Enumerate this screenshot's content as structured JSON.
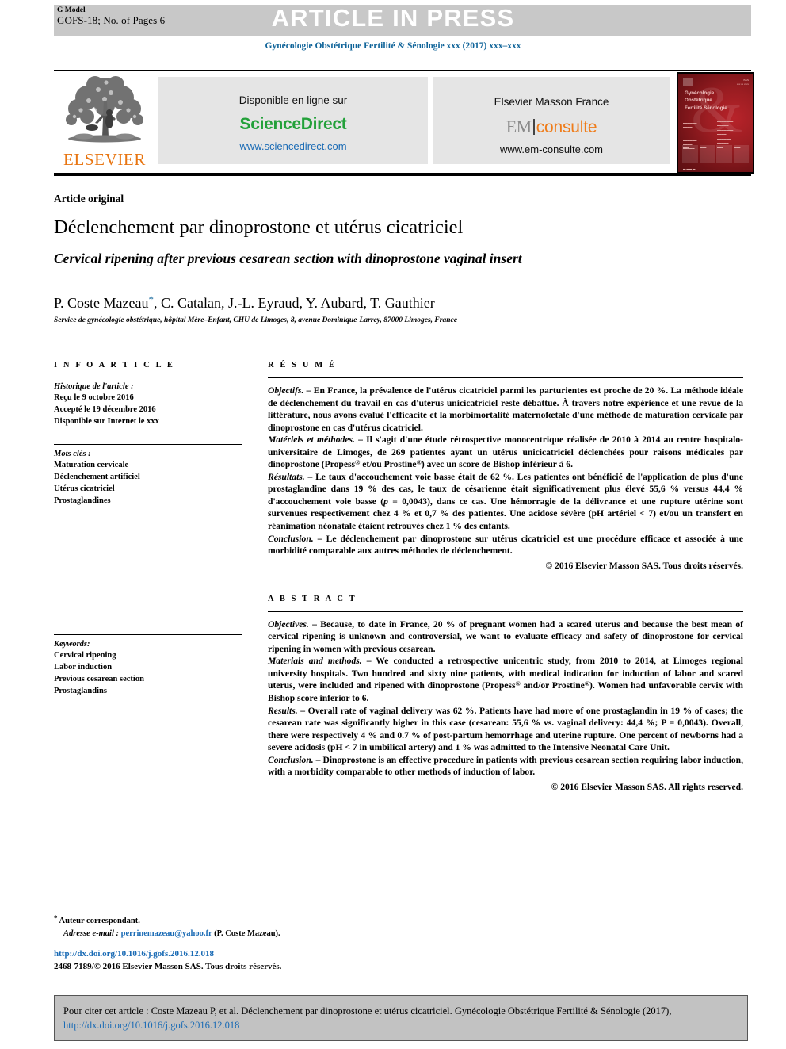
{
  "header": {
    "g_model_label": "G Model",
    "g_model_id": "GOFS-18; No. of Pages 6",
    "banner": "ARTICLE IN PRESS",
    "journal_line": "Gynécologie Obstétrique Fertilité & Sénologie xxx (2017) xxx–xxx"
  },
  "masthead": {
    "elsevier_wordmark": "ELSEVIER",
    "sciencedirect": {
      "available_label": "Disponible en ligne sur",
      "logo": "ScienceDirect",
      "url": "www.sciencedirect.com"
    },
    "em_consulte": {
      "publisher": "Elsevier Masson France",
      "logo_left": "EM",
      "logo_right": "consulte",
      "url": "www.em-consulte.com"
    },
    "cover": {
      "title_lines": "Gynécologie Obstétrique Fertilité Sénologie",
      "ampersand": "&"
    }
  },
  "article": {
    "kind": "Article original",
    "title_fr": "Déclenchement par dinoprostone et utérus cicatriciel",
    "title_en": "Cervical ripening after previous cesarean section with dinoprostone vaginal insert",
    "authors": "P. Coste Mazeau",
    "authors_rest": ", C. Catalan, J.-L. Eyraud, Y. Aubard, T. Gauthier",
    "corresponding_marker": "*",
    "affiliation": "Service de gynécologie obstétrique, hôpital Mère–Enfant, CHU de Limoges, 8, avenue Dominique-Larrey, 87000 Limoges, France"
  },
  "info_article": {
    "heading": "I N F O   A R T I C L E",
    "history_title": "Historique de l'article :",
    "history": [
      "Reçu le 9 octobre 2016",
      "Accepté le 19 décembre 2016",
      "Disponible sur Internet le xxx"
    ],
    "keywords_fr_title": "Mots clés :",
    "keywords_fr": [
      "Maturation cervicale",
      "Déclenchement artificiel",
      "Utérus cicatriciel",
      "Prostaglandines"
    ],
    "keywords_en_title": "Keywords:",
    "keywords_en": [
      "Cervical ripening",
      "Labor induction",
      "Previous cesarean section",
      "Prostaglandins"
    ]
  },
  "resume": {
    "heading": "R É S U M É",
    "objectifs_label": "Objectifs.",
    "objectifs_text": " – En France, la prévalence de l'utérus cicatriciel parmi les parturientes est proche de 20 %. La méthode idéale de déclenchement du travail en cas d'utérus unicicatriciel reste débattue. À travers notre expérience et une revue de la littérature, nous avons évalué l'efficacité et la morbimortalité maternofœtale d'une méthode de maturation cervicale par dinoprostone en cas d'utérus cicatriciel.",
    "materiels_label": "Matériels et méthodes.",
    "materiels_text_a": " – Il s'agit d'une étude rétrospective monocentrique réalisée de 2010 à 2014 au centre hospitalo-universitaire de Limoges, de 269 patientes ayant un utérus unicicatriciel déclenchées pour raisons médicales par dinoprostone (Propess",
    "materiels_text_b": " et/ou Prostine",
    "materiels_text_c": ") avec un score de Bishop inférieur à 6.",
    "resultats_label": "Résultats.",
    "resultats_text_a": " – Le taux d'accouchement voie basse était de 62 %. Les patientes ont bénéficié de l'application de plus d'une prostaglandine dans 19 % des cas, le taux de césarienne était significativement plus élevé 55,6 % versus 44,4 % d'accouchement voie basse (",
    "resultats_text_p": "p",
    "resultats_text_b": " = 0,0043), dans ce cas. Une hémorragie de la délivrance et une rupture utérine sont survenues respectivement chez 4 % et 0,7 % des patientes. Une acidose sévère (pH artériel < 7) et/ou un transfert en réanimation néonatale étaient retrouvés chez 1 % des enfants.",
    "conclusion_label": "Conclusion.",
    "conclusion_text": " – Le déclenchement par dinoprostone sur utérus cicatriciel est une procédure efficace et associée à une morbidité comparable aux autres méthodes de déclenchement.",
    "copyright": "© 2016 Elsevier Masson SAS. Tous droits réservés."
  },
  "abstract": {
    "heading": "A B S T R A C T",
    "objectives_label": "Objectives.",
    "objectives_text": " – Because, to date in France, 20 % of pregnant women had a scared uterus and because the best mean of cervical ripening is unknown and controversial, we want to evaluate efficacy and safety of dinoprostone for cervical ripening in women with previous cesarean.",
    "materials_label": "Materials and methods.",
    "materials_text_a": " – We conducted a retrospective unicentric study, from 2010 to 2014, at Limoges regional university hospitals. Two hundred and sixty nine patients, with medical indication for induction of labor and scared uterus, were included and ripened with dinoprostone (Propess",
    "materials_text_b": " and/or Prostine",
    "materials_text_c": "). Women had unfavorable cervix with Bishop score inferior to 6.",
    "results_label": "Results.",
    "results_text": " – Overall rate of vaginal delivery was 62 %. Patients have had more of one prostaglandin in 19 % of cases; the cesarean rate was significantly higher in this case (cesarean: 55,6 % vs. vaginal delivery: 44,4 %; P = 0,0043). Overall, there were respectively 4 % and 0.7 % of post-partum hemorrhage and uterine rupture. One percent of newborns had a severe acidosis (pH < 7 in umbilical artery) and 1 % was admitted to the Intensive Neonatal Care Unit.",
    "conclusion_label": "Conclusion.",
    "conclusion_text": " – Dinoprostone is an effective procedure in patients with previous cesarean section requiring labor induction, with a morbidity comparable to other methods of induction of labor.",
    "copyright": "© 2016 Elsevier Masson SAS. All rights reserved."
  },
  "footer": {
    "corresponding_marker": "*",
    "corresponding_label": "Auteur correspondant.",
    "email_label": "Adresse e-mail :",
    "email": "perrinemazeau@yahoo.fr",
    "email_owner": "(P. Coste Mazeau).",
    "doi": "http://dx.doi.org/10.1016/j.gofs.2016.12.018",
    "issn_line": "2468-7189/© 2016 Elsevier Masson SAS. Tous droits réservés."
  },
  "citation": {
    "prefix": "Pour citer cet article : Coste Mazeau P, et al. Déclenchement par dinoprostone et utérus cicatriciel. Gynécologie Obstétrique Fertilité & Sénologie (2017), ",
    "link": "http://dx.doi.org/10.1016/j.gofs.2016.12.018"
  },
  "colors": {
    "journal_blue": "#11659a",
    "link_blue": "#1a6bb5",
    "elsevier_orange": "#e87511",
    "sciencedirect_green": "#23a13a",
    "band_gray": "#c8c8c8"
  }
}
